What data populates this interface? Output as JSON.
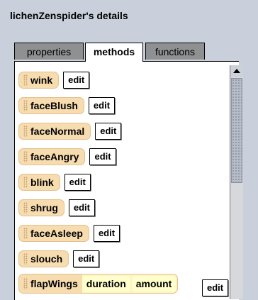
{
  "window": {
    "title": "lichenZenspider's details"
  },
  "tabs": [
    {
      "label": "properties",
      "active": false
    },
    {
      "label": "methods",
      "active": true
    },
    {
      "label": "functions",
      "active": false
    }
  ],
  "methods": [
    {
      "name": "wink",
      "edit_label": "edit"
    },
    {
      "name": "faceBlush",
      "edit_label": "edit"
    },
    {
      "name": "faceNormal",
      "edit_label": "edit"
    },
    {
      "name": "faceAngry",
      "edit_label": "edit"
    },
    {
      "name": "blink",
      "edit_label": "edit"
    },
    {
      "name": "shrug",
      "edit_label": "edit"
    },
    {
      "name": "faceAsleep",
      "edit_label": "edit"
    },
    {
      "name": "slouch",
      "edit_label": "edit"
    }
  ],
  "last_method": {
    "name": "flapWings",
    "params": [
      "duration",
      "amount"
    ],
    "edit_label": "edit"
  },
  "colors": {
    "panel_bg": "#c9d0dc",
    "method_pill": "#f7dcb0",
    "param_bg": "#ffffcc",
    "tab_inactive": "#8f9092"
  }
}
